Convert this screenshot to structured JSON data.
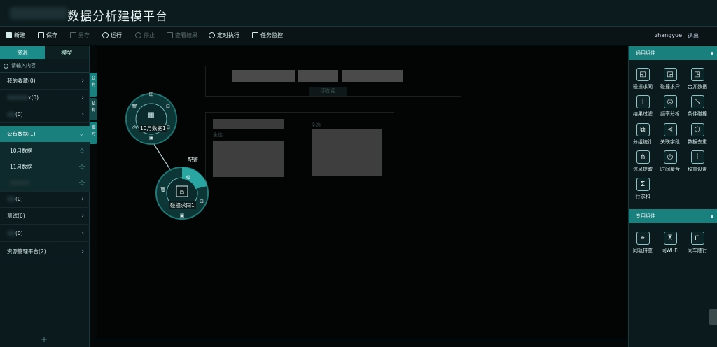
{
  "app": {
    "title": "数据分析建模平台"
  },
  "toolbar": {
    "new": "新建",
    "save": "保存",
    "saveas": "另存",
    "run": "运行",
    "stop": "停止",
    "result": "查看结果",
    "schedule": "定时执行",
    "monitor": "任务监控",
    "user": "zhangyue",
    "logout": "退出"
  },
  "left": {
    "tab_resource": "资源",
    "tab_model": "模型",
    "search_placeholder": "请输入内容",
    "items": {
      "fav": "我的收藏(0)",
      "item2_suffix": "x(0)",
      "item3_suffix": "(0)",
      "public": "公有数据(1)",
      "oct": "10月数据",
      "nov": "11月数据",
      "item7_suffix": "(0)",
      "test": "测试(6)",
      "item9_suffix": "(0)",
      "resmgr": "资源管理平台(2)"
    },
    "add": "+"
  },
  "vtabs": {
    "public": "公有",
    "private": "私有",
    "temp": "临时"
  },
  "canvas": {
    "node1_label": "10月数据1",
    "node2_label": "碰撞求同1",
    "config_label": "配置",
    "ghost_btn": "添加组",
    "ghost_all1": "全选",
    "ghost_all2": "全选"
  },
  "right": {
    "common_header": "通用组件",
    "special_header": "专用组件",
    "common_tools": [
      "碰撞求同",
      "碰撞求异",
      "合并数据",
      "结果过滤",
      "频率分析",
      "条件碰撞",
      "分组统计",
      "关联字段",
      "数据去重",
      "信息提取",
      "时间聚合",
      "权重设置",
      "行求和"
    ],
    "special_tools": [
      "同轨排查",
      "同WI-FI",
      "同车随行"
    ]
  },
  "colors": {
    "accent": "#1a807e",
    "panel": "#0b1a1c",
    "canvas": "#030404"
  },
  "icons": {
    "common": [
      "collide-same-icon",
      "collide-diff-icon",
      "merge-icon",
      "filter-icon",
      "frequency-icon",
      "condition-icon",
      "group-stats-icon",
      "relate-field-icon",
      "dedupe-icon",
      "extract-icon",
      "time-aggregate-icon",
      "weight-icon",
      "sigma-icon"
    ],
    "special": [
      "track-icon",
      "wifi-icon",
      "car-icon"
    ]
  }
}
